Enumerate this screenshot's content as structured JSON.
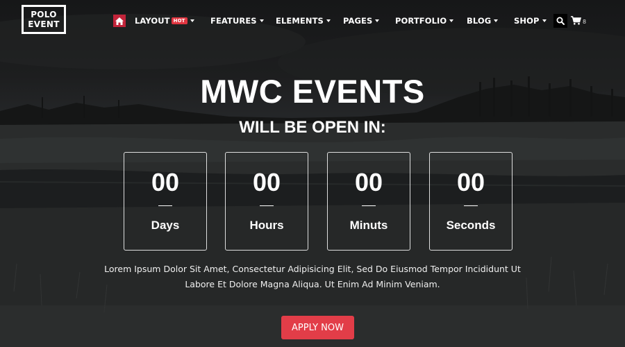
{
  "logo": {
    "line1": "POLO",
    "line2": "EVENT"
  },
  "nav": {
    "home_icon": "home-icon",
    "items": [
      {
        "label": "LAYOUT",
        "badge": "HOT"
      },
      {
        "label": "FEATURES"
      },
      {
        "label": "ELEMENTS"
      },
      {
        "label": "PAGES"
      },
      {
        "label": "PORTFOLIO"
      },
      {
        "label": "BLOG"
      },
      {
        "label": "SHOP"
      }
    ],
    "search_icon": "search-icon",
    "cart_icon": "cart-icon",
    "cart_count": "8"
  },
  "hero": {
    "title": "MWC EVENTS",
    "subtitle": "WILL BE OPEN IN:",
    "countdown": [
      {
        "value": "00",
        "label": "Days"
      },
      {
        "value": "00",
        "label": "Hours"
      },
      {
        "value": "00",
        "label": "Minuts"
      },
      {
        "value": "00",
        "label": "Seconds"
      }
    ],
    "description_line1": "Lorem Ipsum Dolor Sit Amet, Consectetur Adipisicing Elit, Sed Do Eiusmod Tempor Incididunt Ut",
    "description_line2": "Labore Et Dolore Magna Aliqua. Ut Enim Ad Minim Veniam.",
    "cta_label": "APPLY NOW"
  },
  "colors": {
    "accent": "#e23d48",
    "home_button": "#c2243a",
    "overlay": "#1b1c1d"
  }
}
